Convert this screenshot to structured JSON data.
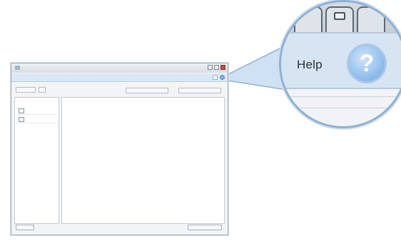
{
  "callout": {
    "label": "Help",
    "icon": "question-circle-icon",
    "glyph": "?",
    "accent_color": "#8fb0d4"
  }
}
